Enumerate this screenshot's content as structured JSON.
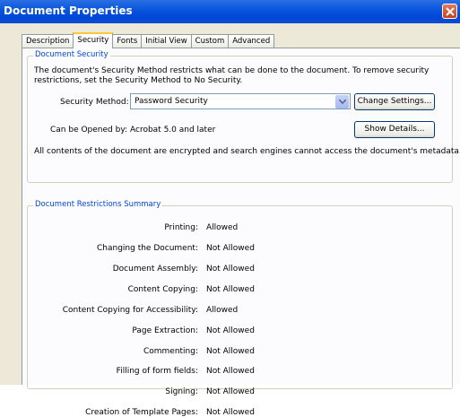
{
  "window": {
    "title": "Document Properties"
  },
  "tabs": [
    "Description",
    "Security",
    "Fonts",
    "Initial View",
    "Custom",
    "Advanced"
  ],
  "active_tab": "Security",
  "document_security": {
    "legend": "Document Security",
    "description_line1": "The document's Security Method restricts what can be done to the document. To remove security",
    "description_line2": "restrictions, set the Security Method to No Security.",
    "method_label": "Security Method:",
    "method_value": "Password Security",
    "change_settings_label": "Change Settings...",
    "opened_by_label": "Can be Opened by:",
    "opened_by_value": "Acrobat 5.0 and later",
    "show_details_label": "Show Details...",
    "encryption_note": "All contents of the document are encrypted and search engines cannot access the document's metadata."
  },
  "restrictions": {
    "legend": "Document Restrictions Summary",
    "rows": [
      {
        "label": "Printing:",
        "value": "Allowed"
      },
      {
        "label": "Changing the Document:",
        "value": "Not Allowed"
      },
      {
        "label": "Document Assembly:",
        "value": "Not Allowed"
      },
      {
        "label": "Content Copying:",
        "value": "Not Allowed"
      },
      {
        "label": "Content Copying for Accessibility:",
        "value": "Allowed"
      },
      {
        "label": "Page Extraction:",
        "value": "Not Allowed"
      },
      {
        "label": "Commenting:",
        "value": "Not Allowed"
      },
      {
        "label": "Filling of form fields:",
        "value": "Not Allowed"
      },
      {
        "label": "Signing:",
        "value": "Not Allowed"
      },
      {
        "label": "Creation of Template Pages:",
        "value": "Not Allowed"
      }
    ]
  }
}
